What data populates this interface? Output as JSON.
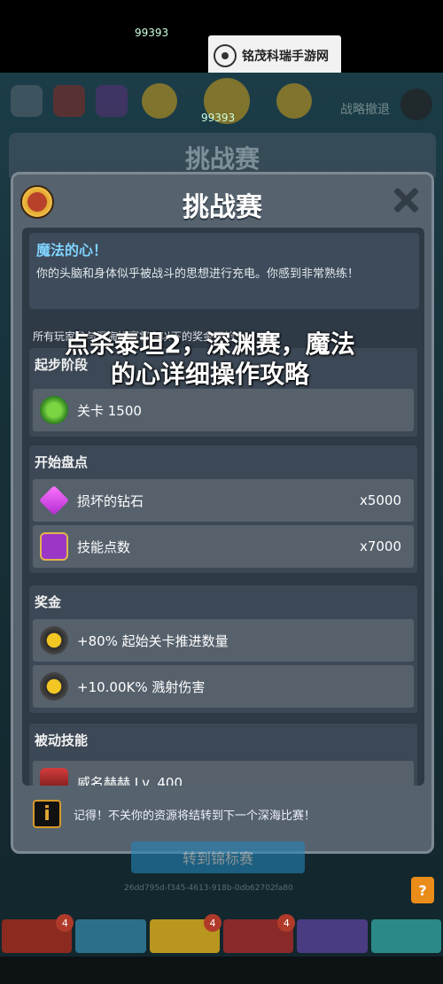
{
  "watermark": {
    "text": "铭茂科瑞手游网"
  },
  "hud": {
    "coins_small": "99393",
    "coins_big": "99393",
    "retreat": "战略撤退"
  },
  "back_title": "挑战赛",
  "dialog": {
    "title": "挑战赛",
    "hero": {
      "title": "魔法的心！",
      "desc": "你的头脑和身体似乎被战斗的思想进行充电。你感到非常熟练！"
    },
    "note": "所有玩家参与深海比赛将有以下的奖金开始",
    "start_stage": {
      "title": "起步阶段",
      "row_label": "关卡 1500"
    },
    "start_inventory": {
      "title": "开始盘点",
      "rows": [
        {
          "label": "损坏的钻石",
          "count": "x5000"
        },
        {
          "label": "技能点数",
          "count": "x7000"
        }
      ]
    },
    "bonus": {
      "title": "奖金",
      "rows": [
        {
          "label": "+80% 起始关卡推进数量"
        },
        {
          "label": "+10.00K% 溅射伤害"
        }
      ]
    },
    "passive": {
      "title": "被动技能",
      "row_label": "威名赫赫 Lv. 400"
    },
    "tip": "记得！不关你的资源将结转到下一个深海比赛！"
  },
  "overlay_title": "点杀泰坦2，深渊赛，魔法的心详细操作攻略",
  "under": {
    "button": "转到锦标赛",
    "hash": "26dd795d-f345-4613-918b-0db62702fa80",
    "help": "?"
  },
  "bottom": {
    "badges": [
      "4",
      "4",
      "4"
    ]
  }
}
